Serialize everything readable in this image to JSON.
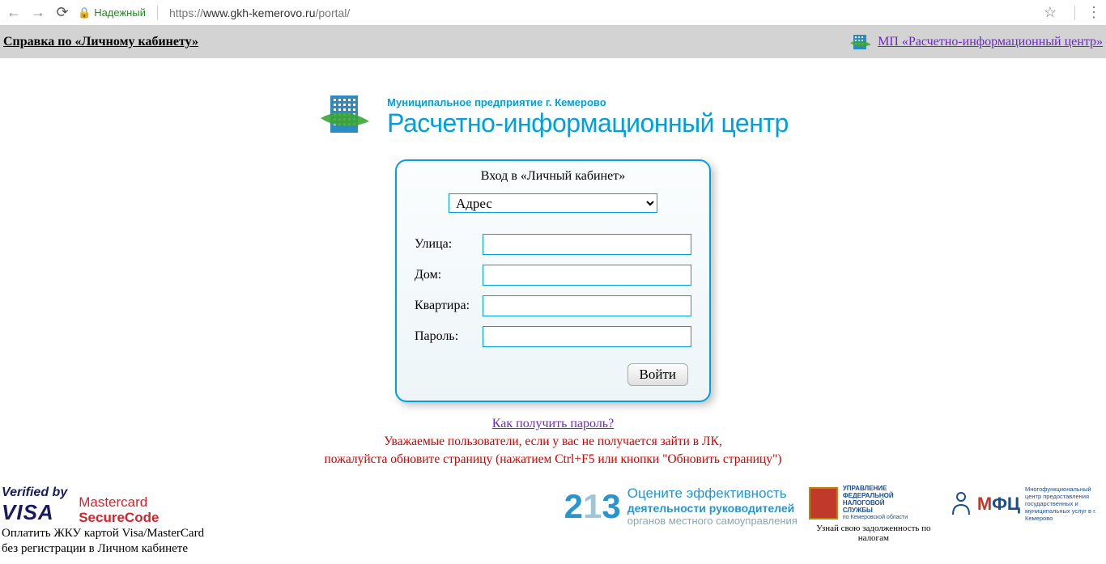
{
  "browser": {
    "secure_label": "Надежный",
    "url_prefix": "https://",
    "url_host": "www.gkh-kemerovo.ru",
    "url_path": "/portal/"
  },
  "header": {
    "help_link": "Справка по «Личному кабинету»",
    "mp_link": "МП «Расчетно-информационный центр»"
  },
  "logo": {
    "subtitle": "Муниципальное предприятие г. Кемерово",
    "title": "Расчетно-информационный центр"
  },
  "login": {
    "panel_title": "Вход в «Личный кабинет»",
    "select_value": "Адрес",
    "fields": {
      "street_label": "Улица:",
      "house_label": "Дом:",
      "apt_label": "Квартира:",
      "password_label": "Пароль:"
    },
    "submit": "Войти"
  },
  "under": {
    "pw_link": "Как получить пароль?",
    "warn_l1": "Уважаемые пользователи, если у вас не получается зайти в ЛК,",
    "warn_l2": "пожалуйста обновите страницу (нажатием Ctrl+F5 или кнопки \"Обновить страницу\")"
  },
  "footer": {
    "visa_top": "Verified by",
    "visa_main": "VISA",
    "mc_top": "Mastercard",
    "mc_bottom": "SecureCode",
    "pay_l1": "Оплатить ЖКУ картой Visa/MasterCard",
    "pay_l2": "без регистрации в Личном кабинете",
    "p213_num": "213",
    "p213_l1": "Оцените эффективность",
    "p213_l2": "деятельности руководителей",
    "p213_l3": "органов местного самоуправления",
    "tax_l1": "УПРАВЛЕНИЕ",
    "tax_l2": "ФЕДЕРАЛЬНОЙ",
    "tax_l3": "НАЛОГОВОЙ",
    "tax_l4": "СЛУЖБЫ",
    "tax_l5": "по Кемеровской области",
    "tax_caption": "Узнай свою задолженность по налогам",
    "mfc_text": "Многофункциональный центр предоставления государственных и муниципальных услуг в г. Кемерово"
  }
}
